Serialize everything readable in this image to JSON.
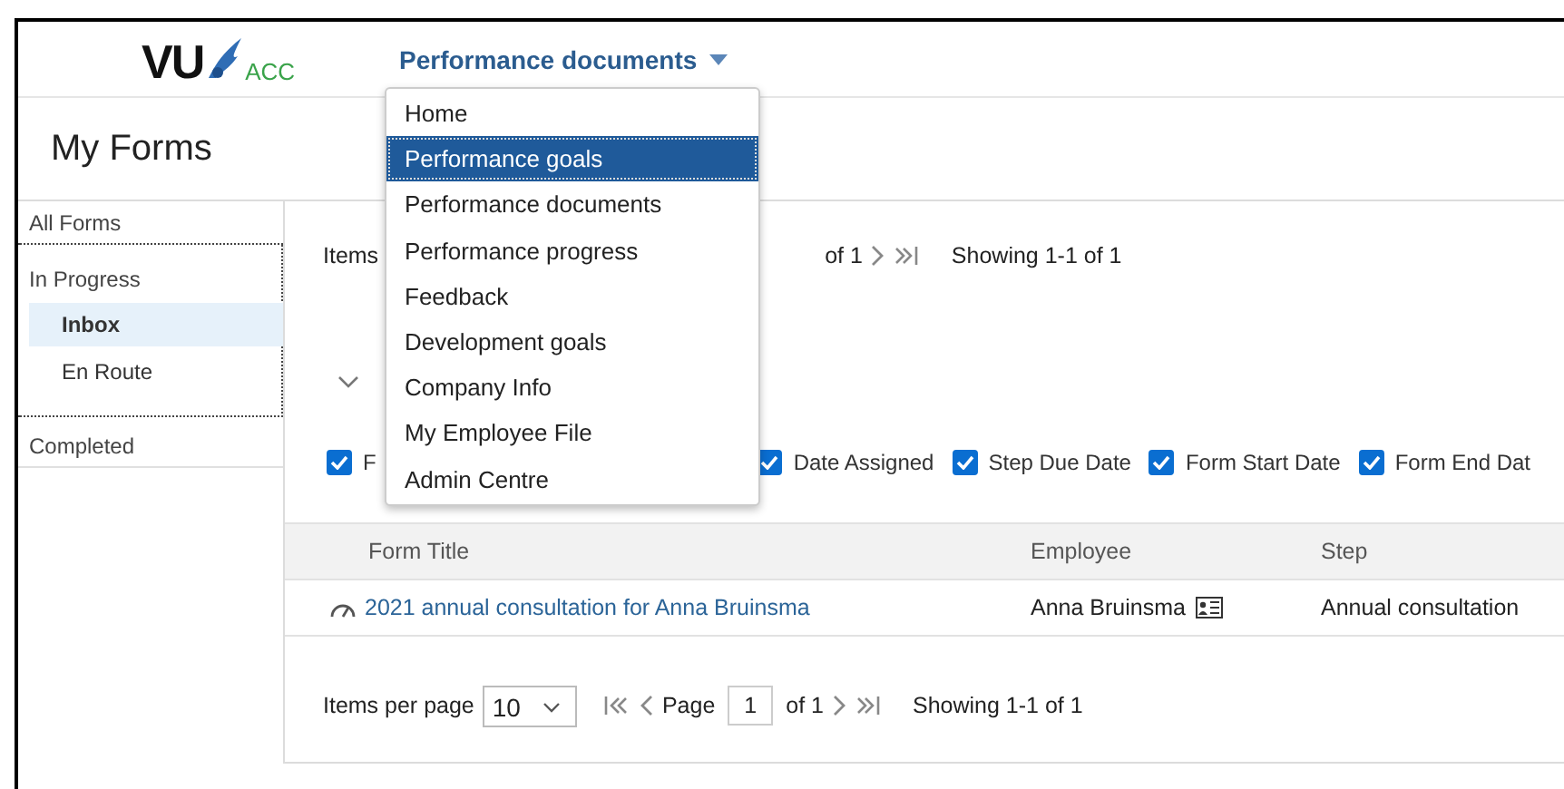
{
  "header": {
    "logo": {
      "text": "VU",
      "suffix": "ACC"
    },
    "nav": {
      "label": "Performance documents",
      "expanded": true
    }
  },
  "menu": [
    {
      "label": "Home",
      "selected": false
    },
    {
      "label": "Performance goals",
      "selected": true
    },
    {
      "label": "Performance documents",
      "selected": false
    },
    {
      "label": "Performance progress",
      "selected": false
    },
    {
      "label": "Feedback",
      "selected": false
    },
    {
      "label": "Development goals",
      "selected": false
    },
    {
      "label": "Company Info",
      "selected": false
    },
    {
      "label": "My Employee File",
      "selected": false
    },
    {
      "label": "Admin Centre",
      "selected": false
    }
  ],
  "page_title": "My Forms",
  "sidebar": {
    "items": [
      {
        "label": "All Forms",
        "selected": false
      },
      {
        "label": "In Progress",
        "selected": false,
        "children": [
          {
            "label": "Inbox",
            "selected": true
          },
          {
            "label": "En Route",
            "selected": false
          }
        ]
      },
      {
        "label": "Completed",
        "selected": false
      }
    ]
  },
  "top_pager": {
    "label": "Items",
    "of": "of 1",
    "showing": "Showing 1-1 of 1"
  },
  "section": {
    "expanded": true
  },
  "column_toggles": [
    {
      "label": "F",
      "checked": true
    },
    {
      "label": "Date Assigned",
      "checked": true
    },
    {
      "label": "Step Due Date",
      "checked": true
    },
    {
      "label": "Form Start Date",
      "checked": true
    },
    {
      "label": "Form End Dat",
      "checked": true
    }
  ],
  "table": {
    "columns": [
      "Form Title",
      "Employee",
      "Step"
    ],
    "rows": [
      {
        "title": "2021 annual consultation for Anna Bruinsma",
        "employee": "Anna Bruinsma",
        "step": "Annual consultation"
      }
    ]
  },
  "bottom_pager": {
    "label": "Items per page",
    "per_page": "10",
    "page_label": "Page",
    "page": "1",
    "of": "of 1",
    "showing": "Showing 1-1 of 1"
  }
}
